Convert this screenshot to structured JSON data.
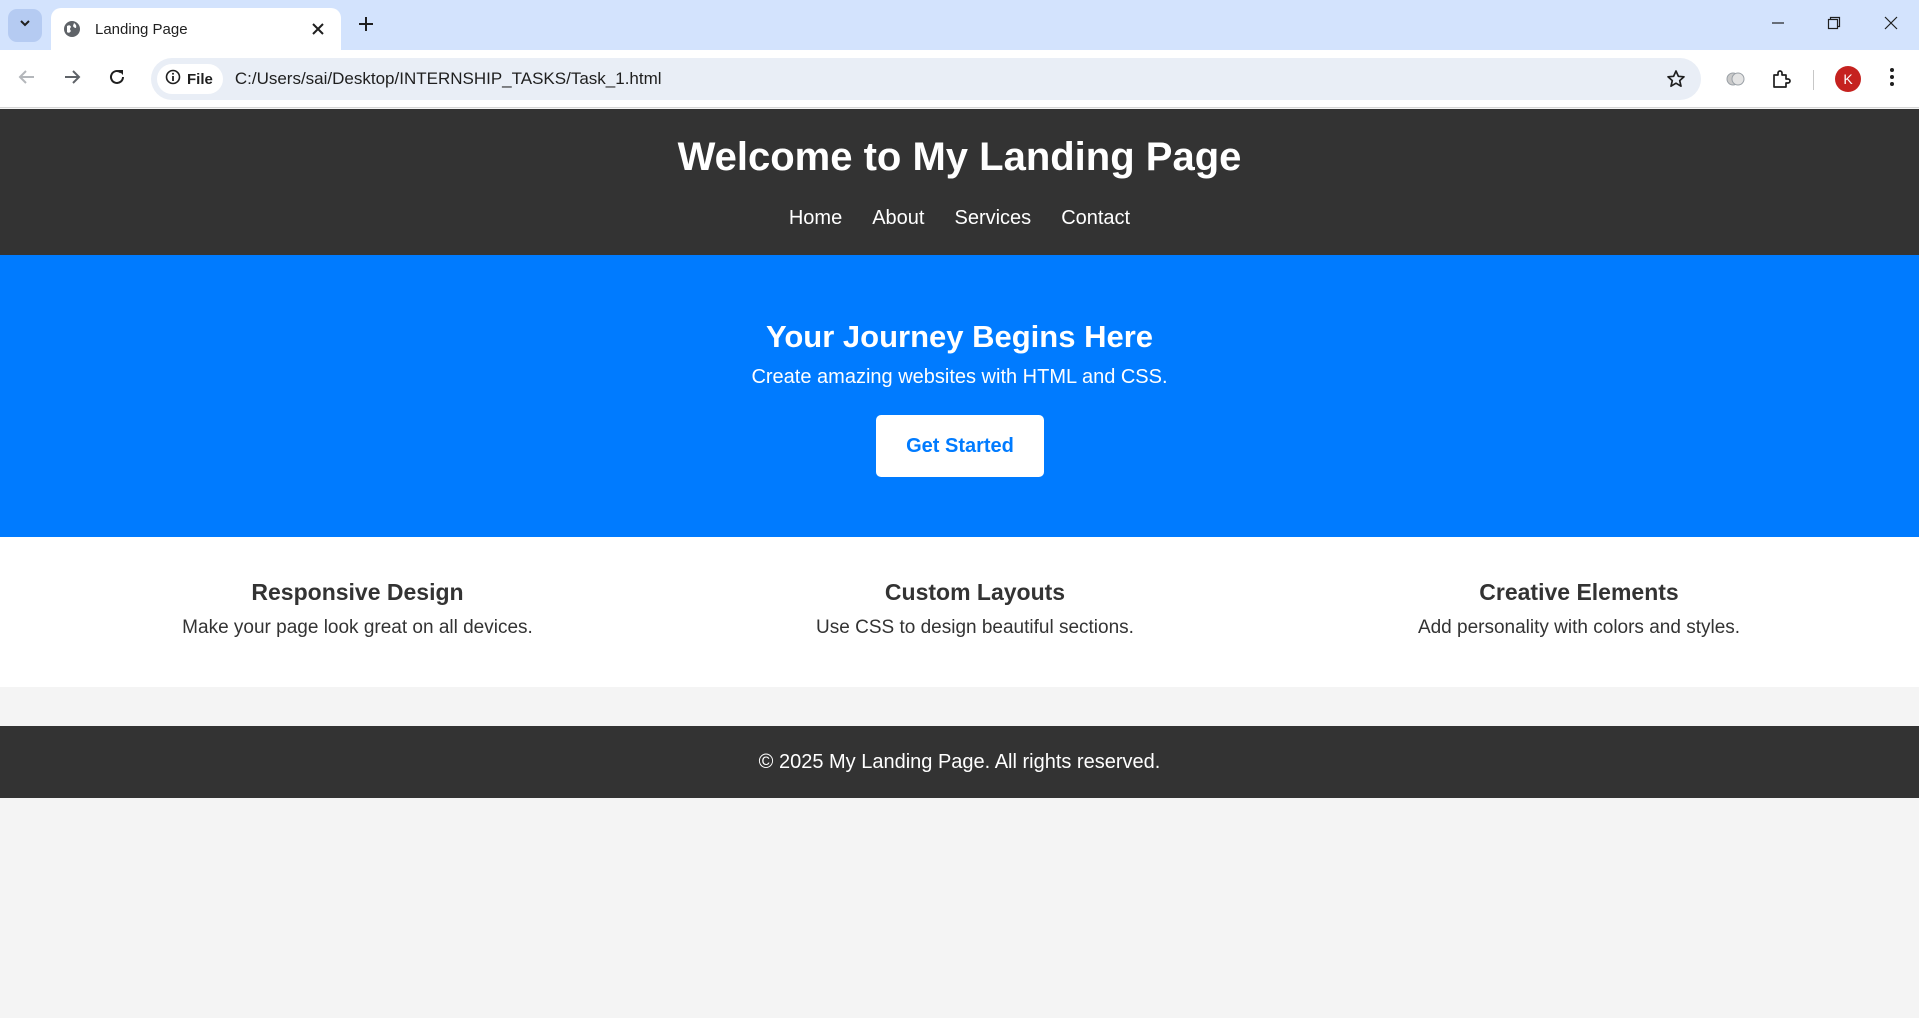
{
  "browser": {
    "tab_title": "Landing Page",
    "site_chip_label": "File",
    "url": "C:/Users/sai/Desktop/INTERNSHIP_TASKS/Task_1.html",
    "profile_initial": "K",
    "profile_color": "#c5221f"
  },
  "header": {
    "title": "Welcome to My Landing Page",
    "nav": [
      "Home",
      "About",
      "Services",
      "Contact"
    ]
  },
  "hero": {
    "title": "Your Journey Begins Here",
    "subtitle": "Create amazing websites with HTML and CSS.",
    "button_label": "Get Started"
  },
  "features": [
    {
      "title": "Responsive Design",
      "desc": "Make your page look great on all devices."
    },
    {
      "title": "Custom Layouts",
      "desc": "Use CSS to design beautiful sections."
    },
    {
      "title": "Creative Elements",
      "desc": "Add personality with colors and styles."
    }
  ],
  "footer": {
    "text": "© 2025 My Landing Page. All rights reserved."
  },
  "colors": {
    "header_bg": "#333333",
    "hero_bg": "#007bff",
    "accent": "#007bff"
  }
}
